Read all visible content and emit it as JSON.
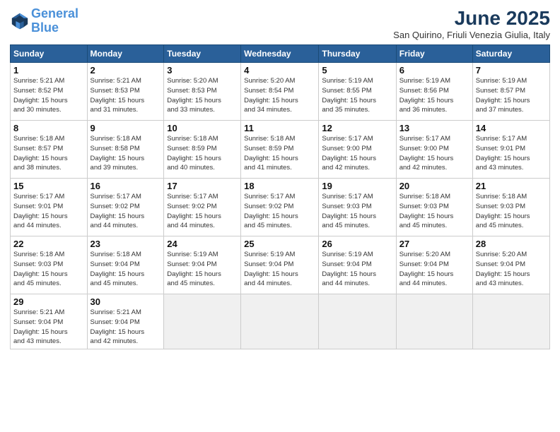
{
  "header": {
    "logo_line1": "General",
    "logo_line2": "Blue",
    "month": "June 2025",
    "location": "San Quirino, Friuli Venezia Giulia, Italy"
  },
  "days_of_week": [
    "Sunday",
    "Monday",
    "Tuesday",
    "Wednesday",
    "Thursday",
    "Friday",
    "Saturday"
  ],
  "weeks": [
    [
      {
        "day": "1",
        "info": "Sunrise: 5:21 AM\nSunset: 8:52 PM\nDaylight: 15 hours\nand 30 minutes."
      },
      {
        "day": "2",
        "info": "Sunrise: 5:21 AM\nSunset: 8:53 PM\nDaylight: 15 hours\nand 31 minutes."
      },
      {
        "day": "3",
        "info": "Sunrise: 5:20 AM\nSunset: 8:53 PM\nDaylight: 15 hours\nand 33 minutes."
      },
      {
        "day": "4",
        "info": "Sunrise: 5:20 AM\nSunset: 8:54 PM\nDaylight: 15 hours\nand 34 minutes."
      },
      {
        "day": "5",
        "info": "Sunrise: 5:19 AM\nSunset: 8:55 PM\nDaylight: 15 hours\nand 35 minutes."
      },
      {
        "day": "6",
        "info": "Sunrise: 5:19 AM\nSunset: 8:56 PM\nDaylight: 15 hours\nand 36 minutes."
      },
      {
        "day": "7",
        "info": "Sunrise: 5:19 AM\nSunset: 8:57 PM\nDaylight: 15 hours\nand 37 minutes."
      }
    ],
    [
      {
        "day": "8",
        "info": "Sunrise: 5:18 AM\nSunset: 8:57 PM\nDaylight: 15 hours\nand 38 minutes."
      },
      {
        "day": "9",
        "info": "Sunrise: 5:18 AM\nSunset: 8:58 PM\nDaylight: 15 hours\nand 39 minutes."
      },
      {
        "day": "10",
        "info": "Sunrise: 5:18 AM\nSunset: 8:59 PM\nDaylight: 15 hours\nand 40 minutes."
      },
      {
        "day": "11",
        "info": "Sunrise: 5:18 AM\nSunset: 8:59 PM\nDaylight: 15 hours\nand 41 minutes."
      },
      {
        "day": "12",
        "info": "Sunrise: 5:17 AM\nSunset: 9:00 PM\nDaylight: 15 hours\nand 42 minutes."
      },
      {
        "day": "13",
        "info": "Sunrise: 5:17 AM\nSunset: 9:00 PM\nDaylight: 15 hours\nand 42 minutes."
      },
      {
        "day": "14",
        "info": "Sunrise: 5:17 AM\nSunset: 9:01 PM\nDaylight: 15 hours\nand 43 minutes."
      }
    ],
    [
      {
        "day": "15",
        "info": "Sunrise: 5:17 AM\nSunset: 9:01 PM\nDaylight: 15 hours\nand 44 minutes."
      },
      {
        "day": "16",
        "info": "Sunrise: 5:17 AM\nSunset: 9:02 PM\nDaylight: 15 hours\nand 44 minutes."
      },
      {
        "day": "17",
        "info": "Sunrise: 5:17 AM\nSunset: 9:02 PM\nDaylight: 15 hours\nand 44 minutes."
      },
      {
        "day": "18",
        "info": "Sunrise: 5:17 AM\nSunset: 9:02 PM\nDaylight: 15 hours\nand 45 minutes."
      },
      {
        "day": "19",
        "info": "Sunrise: 5:17 AM\nSunset: 9:03 PM\nDaylight: 15 hours\nand 45 minutes."
      },
      {
        "day": "20",
        "info": "Sunrise: 5:18 AM\nSunset: 9:03 PM\nDaylight: 15 hours\nand 45 minutes."
      },
      {
        "day": "21",
        "info": "Sunrise: 5:18 AM\nSunset: 9:03 PM\nDaylight: 15 hours\nand 45 minutes."
      }
    ],
    [
      {
        "day": "22",
        "info": "Sunrise: 5:18 AM\nSunset: 9:03 PM\nDaylight: 15 hours\nand 45 minutes."
      },
      {
        "day": "23",
        "info": "Sunrise: 5:18 AM\nSunset: 9:04 PM\nDaylight: 15 hours\nand 45 minutes."
      },
      {
        "day": "24",
        "info": "Sunrise: 5:19 AM\nSunset: 9:04 PM\nDaylight: 15 hours\nand 45 minutes."
      },
      {
        "day": "25",
        "info": "Sunrise: 5:19 AM\nSunset: 9:04 PM\nDaylight: 15 hours\nand 44 minutes."
      },
      {
        "day": "26",
        "info": "Sunrise: 5:19 AM\nSunset: 9:04 PM\nDaylight: 15 hours\nand 44 minutes."
      },
      {
        "day": "27",
        "info": "Sunrise: 5:20 AM\nSunset: 9:04 PM\nDaylight: 15 hours\nand 44 minutes."
      },
      {
        "day": "28",
        "info": "Sunrise: 5:20 AM\nSunset: 9:04 PM\nDaylight: 15 hours\nand 43 minutes."
      }
    ],
    [
      {
        "day": "29",
        "info": "Sunrise: 5:21 AM\nSunset: 9:04 PM\nDaylight: 15 hours\nand 43 minutes."
      },
      {
        "day": "30",
        "info": "Sunrise: 5:21 AM\nSunset: 9:04 PM\nDaylight: 15 hours\nand 42 minutes."
      },
      {
        "day": "",
        "info": ""
      },
      {
        "day": "",
        "info": ""
      },
      {
        "day": "",
        "info": ""
      },
      {
        "day": "",
        "info": ""
      },
      {
        "day": "",
        "info": ""
      }
    ]
  ]
}
